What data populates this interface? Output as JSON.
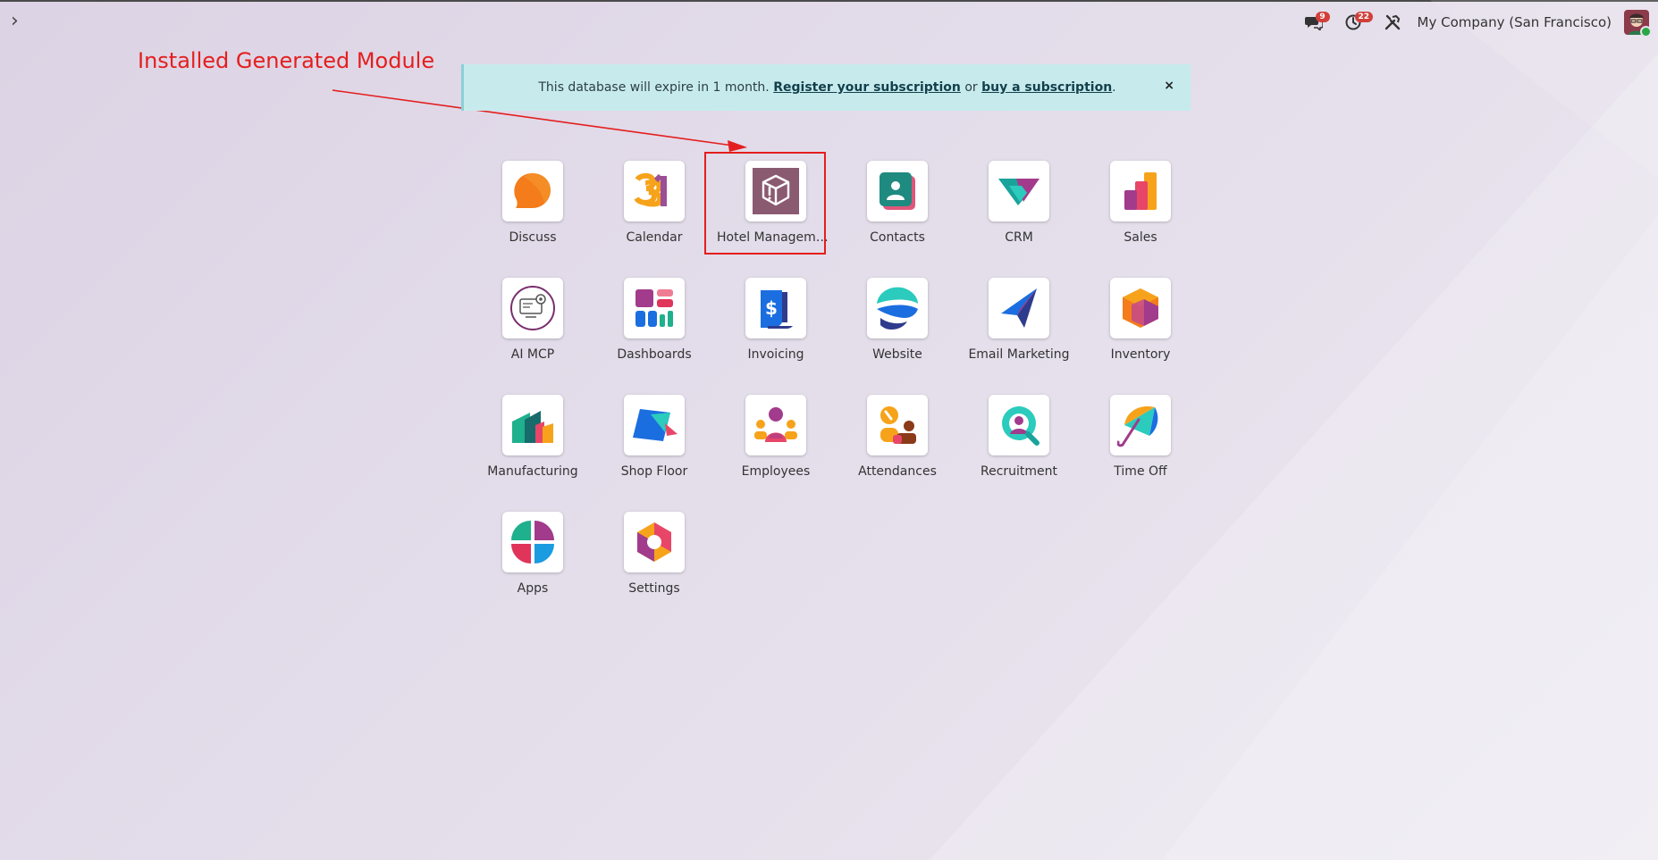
{
  "annotation": {
    "text": "Installed Generated Module",
    "color": "#e41e1e"
  },
  "banner": {
    "text_before": "This database will expire in 1 month.",
    "link_register": "Register your subscription",
    "text_or": "or",
    "link_buy": "buy a subscription",
    "text_after": ".",
    "close": "×"
  },
  "systray": {
    "messages_badge": "9",
    "activities_badge": "22",
    "company": "My Company (San Francisco)"
  },
  "nav": {
    "toggle_glyph": "›"
  },
  "apps": [
    {
      "label": "Discuss",
      "icon": "discuss-icon"
    },
    {
      "label": "Calendar",
      "icon": "calendar-icon"
    },
    {
      "label": "Hotel Management",
      "icon": "hotel-management-icon"
    },
    {
      "label": "Contacts",
      "icon": "contacts-icon"
    },
    {
      "label": "CRM",
      "icon": "crm-icon"
    },
    {
      "label": "Sales",
      "icon": "sales-icon"
    },
    {
      "label": "AI MCP",
      "icon": "ai-mcp-icon"
    },
    {
      "label": "Dashboards",
      "icon": "dashboards-icon"
    },
    {
      "label": "Invoicing",
      "icon": "invoicing-icon"
    },
    {
      "label": "Website",
      "icon": "website-icon"
    },
    {
      "label": "Email Marketing",
      "icon": "email-marketing-icon"
    },
    {
      "label": "Inventory",
      "icon": "inventory-icon"
    },
    {
      "label": "Manufacturing",
      "icon": "manufacturing-icon"
    },
    {
      "label": "Shop Floor",
      "icon": "shop-floor-icon"
    },
    {
      "label": "Employees",
      "icon": "employees-icon"
    },
    {
      "label": "Attendances",
      "icon": "attendances-icon"
    },
    {
      "label": "Recruitment",
      "icon": "recruitment-icon"
    },
    {
      "label": "Time Off",
      "icon": "time-off-icon"
    },
    {
      "label": "Apps",
      "icon": "apps-icon"
    },
    {
      "label": "Settings",
      "icon": "settings-icon"
    }
  ]
}
